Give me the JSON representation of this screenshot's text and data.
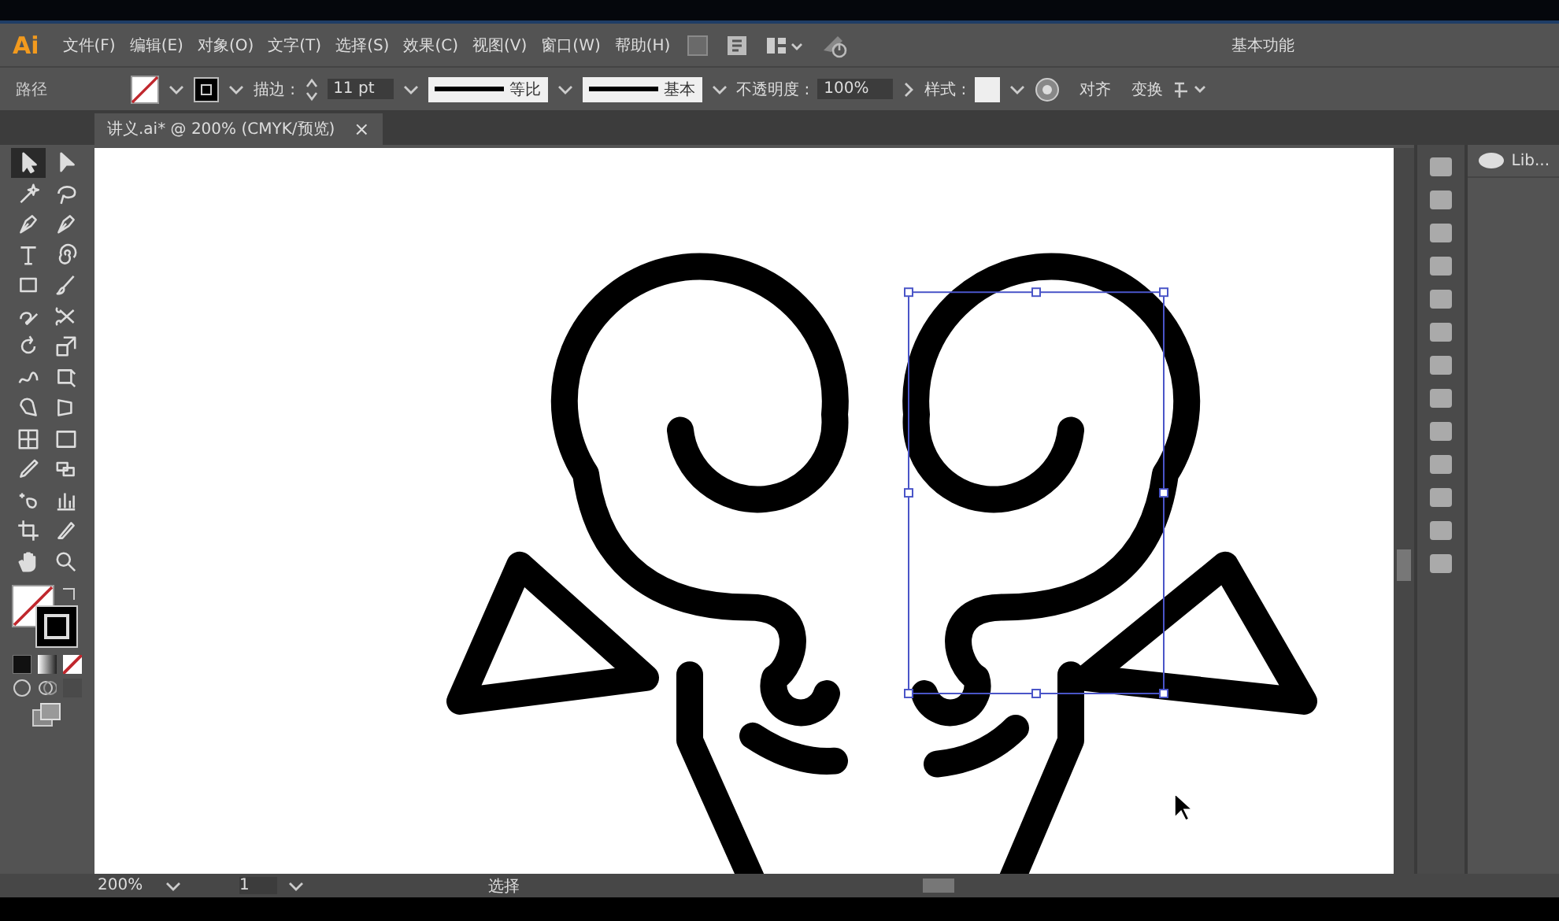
{
  "menu": {
    "logo": "Ai",
    "items": [
      "文件(F)",
      "编辑(E)",
      "对象(O)",
      "文字(T)",
      "选择(S)",
      "效果(C)",
      "视图(V)",
      "窗口(W)",
      "帮助(H)"
    ],
    "workspace": "基本功能"
  },
  "control_bar": {
    "object_type": "路径",
    "stroke_label": "描边 :",
    "stroke_weight": "11 pt",
    "profile": "等比",
    "brush": "基本",
    "opacity_label": "不透明度 :",
    "opacity": "100%",
    "style_label": "样式 :",
    "align": "对齐",
    "transform": "变换"
  },
  "document_tab": {
    "title": "讲义.ai* @ 200% (CMYK/预览)",
    "close": "×"
  },
  "tools": [
    {
      "kind": "select",
      "selected": true
    },
    {
      "kind": "direct",
      "selected": false
    },
    {
      "kind": "wand",
      "selected": false
    },
    {
      "kind": "lasso",
      "selected": false
    },
    {
      "kind": "pen",
      "selected": false
    },
    {
      "kind": "pen",
      "selected": false
    },
    {
      "kind": "type",
      "selected": false
    },
    {
      "kind": "spiral",
      "selected": false
    },
    {
      "kind": "rect",
      "selected": false
    },
    {
      "kind": "brush",
      "selected": false
    },
    {
      "kind": "blob",
      "selected": false
    },
    {
      "kind": "scissors",
      "selected": false
    },
    {
      "kind": "rotate",
      "selected": false
    },
    {
      "kind": "scale",
      "selected": false
    },
    {
      "kind": "warp",
      "selected": false
    },
    {
      "kind": "free",
      "selected": false
    },
    {
      "kind": "shape",
      "selected": false
    },
    {
      "kind": "persp",
      "selected": false
    },
    {
      "kind": "mesh",
      "selected": false
    },
    {
      "kind": "gradient",
      "selected": false
    },
    {
      "kind": "eyedrop",
      "selected": false
    },
    {
      "kind": "blend",
      "selected": false
    },
    {
      "kind": "symbol",
      "selected": false
    },
    {
      "kind": "graph",
      "selected": false
    },
    {
      "kind": "artboard",
      "selected": false
    },
    {
      "kind": "knife",
      "selected": false
    },
    {
      "kind": "hand",
      "selected": false
    },
    {
      "kind": "zoom",
      "selected": false
    }
  ],
  "libraries_panel": {
    "title": "Lib..."
  },
  "status_bar": {
    "zoom": "200%",
    "artboard": "1",
    "tool": "选择"
  }
}
